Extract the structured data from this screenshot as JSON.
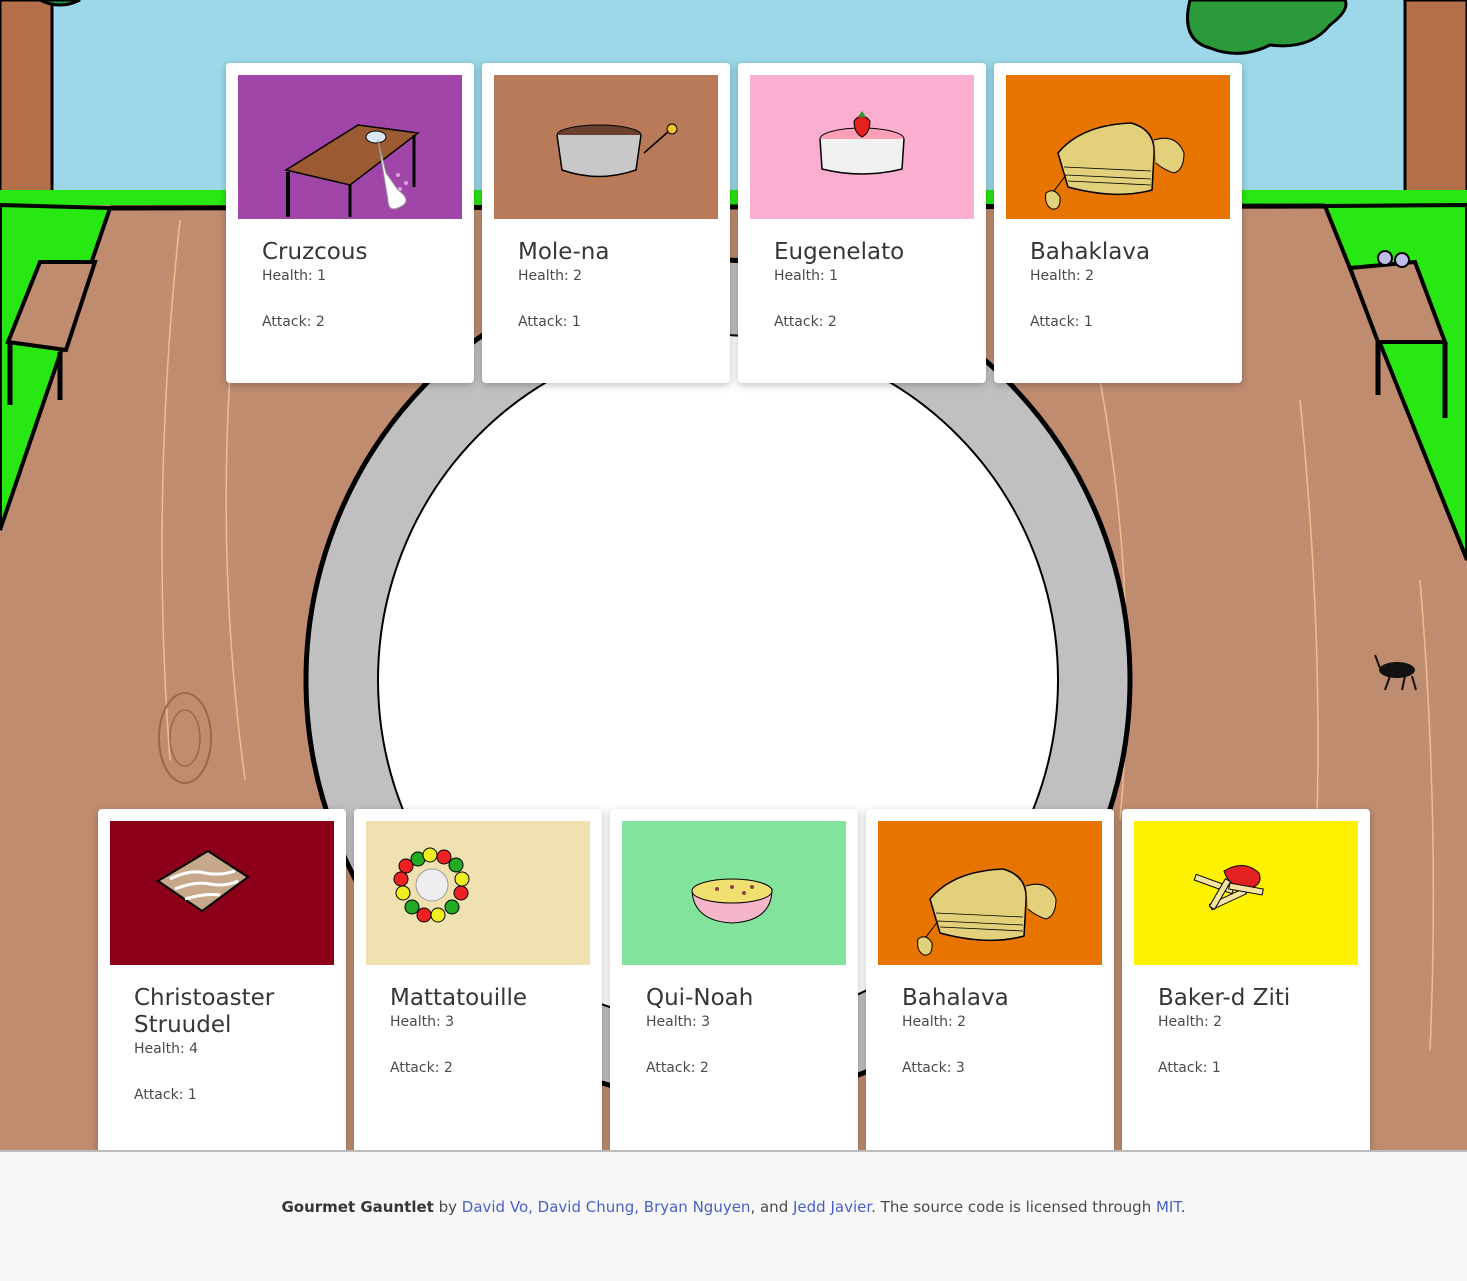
{
  "top_row": [
    {
      "name": "Cruzcous",
      "health_label": "Health: 1",
      "attack_label": "Attack: 2",
      "art_bg": "#a046a8",
      "art": "table-spill"
    },
    {
      "name": "Mole-na",
      "health_label": "Health: 2",
      "attack_label": "Attack: 1",
      "art_bg": "#b87a58",
      "art": "pot"
    },
    {
      "name": "Eugenelato",
      "health_label": "Health: 1",
      "attack_label": "Attack: 2",
      "art_bg": "#fcaed0",
      "art": "cake"
    },
    {
      "name": "Bahaklava",
      "health_label": "Health: 2",
      "attack_label": "Attack: 1",
      "art_bg": "#e87400",
      "art": "baklava"
    }
  ],
  "bottom_row": [
    {
      "name": "Christoaster Struudel",
      "health_label": "Health: 4",
      "attack_label": "Attack: 1",
      "art_bg": "#8b0018",
      "art": "strudel"
    },
    {
      "name": "Mattatouille",
      "health_label": "Health: 3",
      "attack_label": "Attack: 2",
      "art_bg": "#f0e2b0",
      "art": "ratatouille"
    },
    {
      "name": "Qui-Noah",
      "health_label": "Health: 3",
      "attack_label": "Attack: 2",
      "art_bg": "#82e49c",
      "art": "bowl"
    },
    {
      "name": "Bahalava",
      "health_label": "Health: 2",
      "attack_label": "Attack: 3",
      "art_bg": "#e87400",
      "art": "baklava"
    },
    {
      "name": "Baker-d Ziti",
      "health_label": "Health: 2",
      "attack_label": "Attack: 1",
      "art_bg": "#fff200",
      "art": "ziti"
    }
  ],
  "footer": {
    "app_name": "Gourmet Gauntlet",
    "by": " by ",
    "authors_1": "David Vo, David Chung, Bryan Nguyen",
    "and": ", and ",
    "authors_2": "Jedd Javier",
    "license_text": ". The source code is licensed through ",
    "license_link": "MIT",
    "end": "."
  },
  "colors": {
    "sky": "#9cd8ea",
    "grass": "#27e812",
    "wood": "#c08c70",
    "plate_rim": "#c0c0c0",
    "plate": "#ffffff",
    "link": "#485fc7"
  }
}
